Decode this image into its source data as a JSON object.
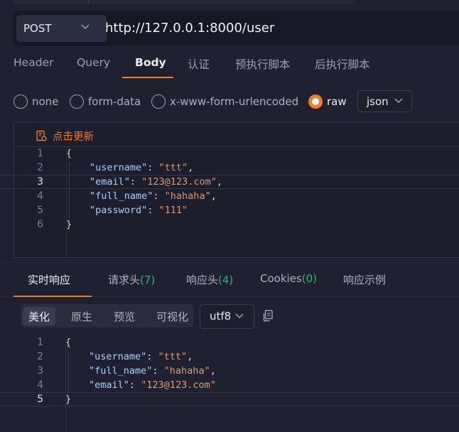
{
  "request": {
    "method": "POST",
    "url": "http://127.0.0.1:8000/user"
  },
  "tabs": [
    "Header",
    "Query",
    "Body",
    "认证",
    "预执行脚本",
    "后执行脚本"
  ],
  "active_tab": "Body",
  "body_types": [
    "none",
    "form-data",
    "x-www-form-urlencoded",
    "raw"
  ],
  "selected_body_type": "raw",
  "format": "json",
  "editor": {
    "update_label": "点击更新",
    "line_numbers": [
      "1",
      "2",
      "3",
      "4",
      "5",
      "6"
    ],
    "lines": [
      "{",
      "\"username\": \"ttt\",",
      "\"email\": \"123@123.com\",",
      "\"full_name\": \"hahaha\",",
      "\"password\": \"111\"",
      "}"
    ],
    "current_line": 3
  },
  "response": {
    "tabs": [
      {
        "label": "实时响应",
        "count": ""
      },
      {
        "label": "请求头",
        "count": "(7)"
      },
      {
        "label": "响应头",
        "count": "(4)"
      },
      {
        "label": "Cookies",
        "count": "(0)"
      },
      {
        "label": "响应示例",
        "count": ""
      }
    ],
    "active_tab": "实时响应",
    "view_modes": [
      "美化",
      "原生",
      "预览",
      "可视化"
    ],
    "active_view": "美化",
    "encoding": "utf8",
    "line_numbers": [
      "1",
      "2",
      "3",
      "4",
      "5"
    ],
    "lines": [
      "{",
      "\"username\": \"ttt\",",
      "\"full_name\": \"hahaha\",",
      "\"email\": \"123@123.com\"",
      "}"
    ],
    "current_line": 5
  },
  "colors": {
    "accent": "#f07c24",
    "count": "#2bb673",
    "json_key": "#9dd6ff",
    "json_string": "#e0996c",
    "background": "#1f2130"
  },
  "icons": [
    "chevron-down-icon",
    "refresh-doc-icon",
    "copy-icon"
  ]
}
